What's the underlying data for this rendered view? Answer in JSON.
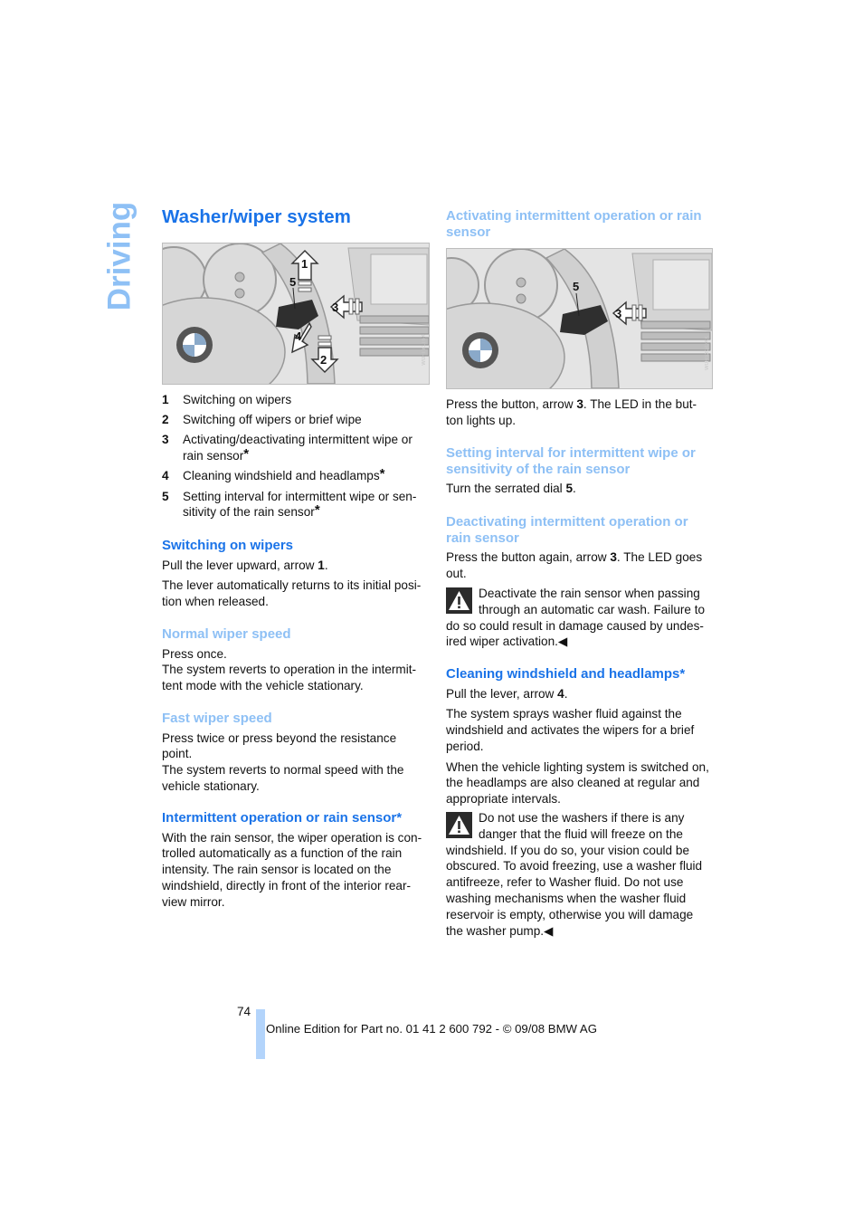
{
  "section_tab": "Driving",
  "page_title": "Washer/wiper system",
  "figure_1": {
    "callouts": [
      "1",
      "5",
      "3",
      "4",
      "2"
    ],
    "code": "W0FTY1T6K"
  },
  "legend": [
    {
      "num": "1",
      "text": "Switching on wipers",
      "star": false
    },
    {
      "num": "2",
      "text": "Switching off wipers or brief wipe",
      "star": false
    },
    {
      "num": "3",
      "text": "Activating/deactivating intermittent wipe or rain sensor",
      "star": true
    },
    {
      "num": "4",
      "text": "Cleaning windshield and headlamps",
      "star": true
    },
    {
      "num": "5",
      "text": "Setting interval for intermittent wipe or sen-sitivity of the rain sensor",
      "star": true
    }
  ],
  "star_symbol": "*",
  "left": {
    "switching_on": {
      "heading": "Switching on wipers",
      "p1_pre": "Pull the lever upward, arrow ",
      "p1_bold": "1",
      "p1_post": ".",
      "p2": "The lever automatically returns to its initial posi-tion when released."
    },
    "normal_speed": {
      "heading": "Normal wiper speed",
      "line1": "Press once.",
      "line2": "The system reverts to operation in the intermit-tent mode with the vehicle stationary."
    },
    "fast_speed": {
      "heading": "Fast wiper speed",
      "line1": "Press twice or press beyond the resistance point.",
      "line2": "The system reverts to normal speed with the vehicle stationary."
    },
    "intermittent": {
      "heading": "Intermittent operation or rain sensor*",
      "p1": "With the rain sensor, the wiper operation is con-trolled automatically as a function of the rain intensity. The rain sensor is located on the windshield, directly in front of the interior rear-view mirror."
    }
  },
  "right": {
    "activating": {
      "heading": "Activating intermittent operation or rain sensor",
      "p1_pre": "Press the button, arrow ",
      "p1_bold": "3",
      "p1_post": ". The LED in the but-ton lights up."
    },
    "figure_2": {
      "callouts": [
        "5",
        "3"
      ],
      "code": "W0HS2GOAK"
    },
    "setting_interval": {
      "heading": "Setting interval for intermittent wipe or sensitivity of the rain sensor",
      "p1_pre": "Turn the serrated dial ",
      "p1_bold": "5",
      "p1_post": "."
    },
    "deactivating": {
      "heading": "Deactivating intermittent operation or rain sensor",
      "p1_pre": "Press the button again, arrow ",
      "p1_bold": "3",
      "p1_post": ". The LED goes out."
    },
    "warning_1": "Deactivate the rain sensor when passing through an automatic car wash. Failure to do so could result in damage caused by undes-ired wiper activation.◀",
    "cleaning": {
      "heading": "Cleaning windshield and headlamps*",
      "p1_pre": "Pull the lever, arrow ",
      "p1_bold": "4",
      "p1_post": ".",
      "p2": "The system sprays washer fluid against the windshield and activates the wipers for a brief period.",
      "p3": "When the vehicle lighting system is switched on, the headlamps are also cleaned at regular and appropriate intervals."
    },
    "warning_2": "Do not use the washers if there is any danger that the fluid will freeze on the windshield. If you do so, your vision could be obscured. To avoid freezing, use a washer fluid antifreeze, refer to Washer fluid. Do not use washing mechanisms when the washer fluid reservoir is empty, otherwise you will damage the washer pump.◀"
  },
  "footer": {
    "page_number": "74",
    "edition": "Online Edition for Part no. 01 41 2 600 792 - © 09/08 BMW AG"
  },
  "colors": {
    "heading_strong": "#1a73e8",
    "heading_light": "#8ec0f5",
    "tab": "#8ec0f5",
    "footer_bar": "#b3d4fb"
  }
}
